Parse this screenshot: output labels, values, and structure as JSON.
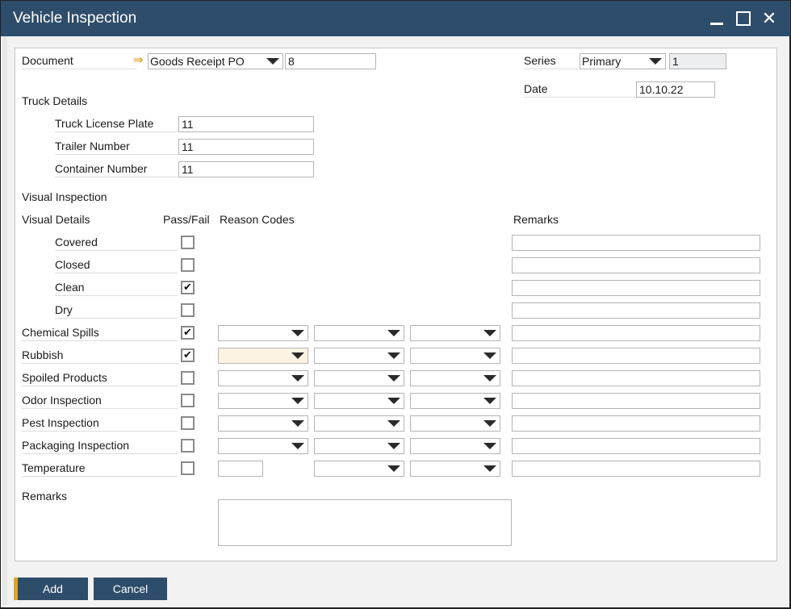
{
  "window": {
    "title": "Vehicle Inspection",
    "controls": {
      "minimize": "minimize",
      "maximize": "maximize",
      "close": "✕"
    }
  },
  "header": {
    "document_label": "Document",
    "document_type": "Goods Receipt PO",
    "document_number": "8",
    "series_label": "Series",
    "series_value": "Primary",
    "series_number": "1",
    "date_label": "Date",
    "date_value": "10.10.22"
  },
  "truck_details": {
    "section_label": "Truck Details",
    "fields": [
      {
        "label": "Truck License Plate",
        "value": "11"
      },
      {
        "label": "Trailer Number",
        "value": "11"
      },
      {
        "label": "Container Number",
        "value": "11"
      }
    ]
  },
  "visual_inspection": {
    "section_label": "Visual Inspection",
    "columns": {
      "details": "Visual Details",
      "pass_fail": "Pass/Fail",
      "reason_codes": "Reason Codes",
      "remarks": "Remarks"
    },
    "rows": [
      {
        "label": "Covered",
        "checked": false,
        "indent": true,
        "reason_type": "none",
        "reason1": "",
        "reason2": "",
        "reason3": "",
        "remark": ""
      },
      {
        "label": "Closed",
        "checked": false,
        "indent": true,
        "reason_type": "none",
        "reason1": "",
        "reason2": "",
        "reason3": "",
        "remark": ""
      },
      {
        "label": "Clean",
        "checked": true,
        "indent": true,
        "reason_type": "none",
        "reason1": "",
        "reason2": "",
        "reason3": "",
        "remark": ""
      },
      {
        "label": "Dry",
        "checked": false,
        "indent": true,
        "reason_type": "none",
        "reason1": "",
        "reason2": "",
        "reason3": "",
        "remark": ""
      },
      {
        "label": "Chemical Spills",
        "checked": true,
        "indent": false,
        "reason_type": "combo",
        "reason1": "",
        "reason2": "",
        "reason3": "",
        "remark": ""
      },
      {
        "label": "Rubbish",
        "checked": true,
        "indent": false,
        "reason_type": "combo",
        "reason1": "",
        "reason2": "",
        "reason3": "",
        "remark": "",
        "focused": true
      },
      {
        "label": "Spoiled Products",
        "checked": false,
        "indent": false,
        "reason_type": "combo",
        "reason1": "",
        "reason2": "",
        "reason3": "",
        "remark": ""
      },
      {
        "label": "Odor Inspection",
        "checked": false,
        "indent": false,
        "reason_type": "combo",
        "reason1": "",
        "reason2": "",
        "reason3": "",
        "remark": ""
      },
      {
        "label": "Pest Inspection",
        "checked": false,
        "indent": false,
        "reason_type": "combo",
        "reason1": "",
        "reason2": "",
        "reason3": "",
        "remark": ""
      },
      {
        "label": "Packaging Inspection",
        "checked": false,
        "indent": false,
        "reason_type": "combo",
        "reason1": "",
        "reason2": "",
        "reason3": "",
        "remark": ""
      },
      {
        "label": "Temperature",
        "checked": false,
        "indent": false,
        "reason_type": "text",
        "reason1": "",
        "reason2": "",
        "reason3": "",
        "remark": ""
      }
    ]
  },
  "remarks": {
    "label": "Remarks",
    "value": ""
  },
  "buttons": {
    "add": "Add",
    "cancel": "Cancel"
  },
  "colors": {
    "titlebar": "#2e4d6b",
    "accent": "#e0a526",
    "focus_field": "#fdf3e3"
  }
}
